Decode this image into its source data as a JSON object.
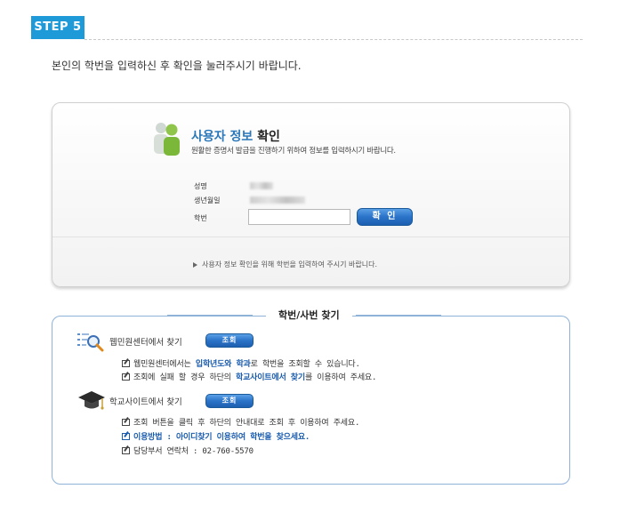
{
  "step": {
    "label": "STEP 5"
  },
  "instruction": "본인의 학번을 입력하신 후 확인을 눌러주시기 바랍니다.",
  "verify": {
    "title_part1": "사용자 정보",
    "title_part2": " 확인",
    "subtitle": "원활한 증명서 발급을 진행하기 위하여 정보를 입력하시기 바랍니다.",
    "fields": {
      "name_label": "성명",
      "birth_label": "생년월일",
      "id_label": "학번",
      "id_value": "",
      "id_placeholder": ""
    },
    "confirm_label": "확 인",
    "note": "사용자 정보 확인을 위해 학번을 입력하여 주시기 바랍니다."
  },
  "find": {
    "title": "학번/사번 찾기",
    "web": {
      "heading": "웹민원센터에서 찾기",
      "button": "조회",
      "line1_pre": "웹민원센터에서는 ",
      "line1_hl": "입학년도와 학과",
      "line1_post": "로 학번을 조회할 수 있습니다.",
      "line2_pre": "조회에 실패 할 경우 하단의 ",
      "line2_hl": "학교사이트에서 찾기",
      "line2_post": "를 이용하여 주세요."
    },
    "school": {
      "heading": "학교사이트에서 찾기",
      "button": "조회",
      "line1": "조회 버튼을 클릭 후 하단의 안내대로 조회 후 이용하여 주세요.",
      "line2": "이용방법 : 아이디찾기 이용하여 학번을 찾으세요.",
      "line3": "담당부서 연락처 : 02-760-5570"
    }
  },
  "colors": {
    "accent": "#1f9ad9",
    "button": "#2a73c8",
    "title_blue": "#2a77b9",
    "border_blue": "#8fb2d8"
  }
}
